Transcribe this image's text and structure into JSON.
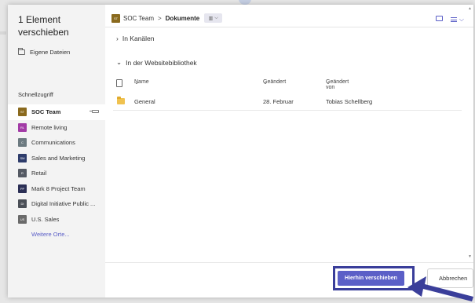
{
  "dialog": {
    "title": "1 Element verschieben",
    "own_files": "Eigene Dateien",
    "quick_access": "Schnellzugriff",
    "more_places": "Weitere Orte...",
    "quick_items": [
      {
        "label": "SOC Team",
        "initials": "ST",
        "color": "#8a6a1e",
        "active": true
      },
      {
        "label": "Remote living",
        "initials": "RL",
        "color": "#a23ba6",
        "active": false
      },
      {
        "label": "Communications",
        "initials": "C",
        "color": "#6c7a80",
        "active": false
      },
      {
        "label": "Sales and Marketing",
        "initials": "SM",
        "color": "#2e3c6b",
        "active": false
      },
      {
        "label": "Retail",
        "initials": "R",
        "color": "#555a64",
        "active": false
      },
      {
        "label": "Mark 8 Project Team",
        "initials": "PP",
        "color": "#2b2f55",
        "active": false
      },
      {
        "label": "Digital Initiative Public ...",
        "initials": "DI",
        "color": "#4b4f57",
        "active": false
      },
      {
        "label": "U.S. Sales",
        "initials": "US",
        "color": "#6a6a6a",
        "active": false
      }
    ]
  },
  "breadcrumb": {
    "team_initials": "ST",
    "team": "SOC Team",
    "current": "Dokumente",
    "separator": ">"
  },
  "sections": {
    "channels": "In Kanälen",
    "library": "In der Websitebibliothek"
  },
  "table": {
    "col_name": "Name",
    "col_modified": "Geändert",
    "col_modified_by": "Geändert von",
    "rows": [
      {
        "name": "General",
        "modified": "28. Februar",
        "modified_by": "Tobias Schellberg"
      }
    ]
  },
  "footer": {
    "primary": "Hierhin verschieben",
    "secondary": "Abbrechen"
  },
  "colors": {
    "accent": "#5b5fc7",
    "highlight": "#3a3e9a"
  },
  "icons": [
    "folder-icon",
    "chevron-right-icon",
    "chevron-down-icon",
    "pin-icon",
    "document-icon",
    "library-icon",
    "new-folder-icon",
    "view-options-icon",
    "arrow-pointer-icon"
  ]
}
